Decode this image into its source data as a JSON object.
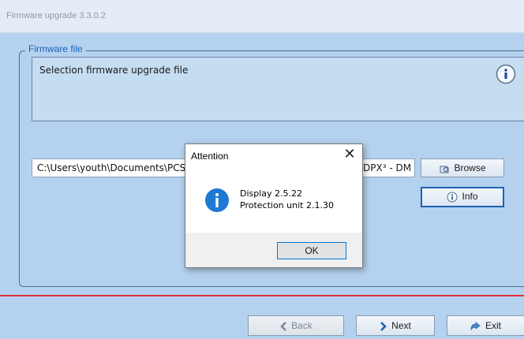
{
  "window": {
    "title": "Firmware upgrade 3.3.0.2"
  },
  "firmware_group": {
    "legend": "Firmware file",
    "description": "Selection firmware upgrade file",
    "path_value": "C:\\Users\\youth\\Documents\\PCS",
    "path_tail": "DPX³ - DM"
  },
  "buttons": {
    "browse": "Browse",
    "info": "Info",
    "back": "Back",
    "next": "Next",
    "exit": "Exit"
  },
  "dialog": {
    "title": "Attention",
    "line1": "Display 2.5.22",
    "line2": "Protection unit 2.1.30",
    "ok": "OK"
  },
  "colors": {
    "background": "#b4d2ef",
    "accent": "#1e5fb4",
    "separator": "#e23030"
  }
}
